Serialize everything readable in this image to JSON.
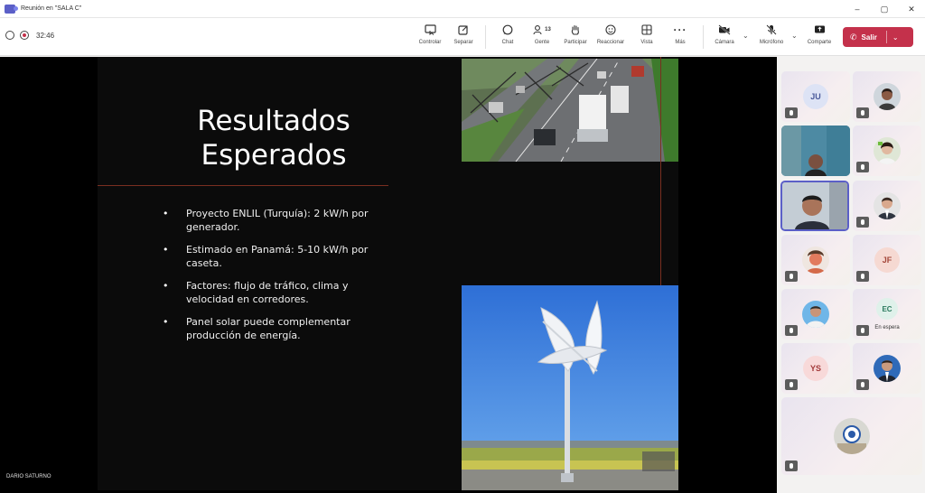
{
  "window": {
    "title": "Reunión en \"SALA C\"",
    "controls": [
      "–",
      "▢",
      "✕"
    ]
  },
  "status": {
    "timer": "32:46"
  },
  "toolbar": {
    "buttons": [
      {
        "label": "Controlar",
        "icon": "screen-control-icon"
      },
      {
        "label": "Separar",
        "icon": "pop-out-icon"
      },
      {
        "label": "Chat",
        "icon": "chat-icon"
      },
      {
        "label": "Gente",
        "icon": "people-icon",
        "count": "13"
      },
      {
        "label": "Participar",
        "icon": "raise-hand-icon"
      },
      {
        "label": "Reaccionar",
        "icon": "emoji-icon"
      },
      {
        "label": "Vista",
        "icon": "grid-view-icon"
      },
      {
        "label": "Más",
        "icon": "more-icon"
      },
      {
        "label": "Cámara",
        "icon": "camera-off-icon"
      },
      {
        "label": "Micrófono",
        "icon": "mic-off-icon"
      },
      {
        "label": "Comparte",
        "icon": "share-icon"
      }
    ],
    "leave_label": "Salir"
  },
  "slide": {
    "title_line1": "Resultados",
    "title_line2": "Esperados",
    "bullets": [
      "Proyecto ENLIL (Turquía): 2 kW/h por generador.",
      "Estimado en Panamá: 5-10 kW/h por caseta.",
      "Factores: flujo de tráfico, clima y velocidad en corredores.",
      "Panel solar puede complementar producción de energía."
    ],
    "presenter": "DARIO SATURNO"
  },
  "gallery": {
    "tiles": [
      {
        "type": "initials",
        "text": "JU",
        "bg": "#dde3f5",
        "fg": "#4a5a9a"
      },
      {
        "type": "photo"
      },
      {
        "type": "video"
      },
      {
        "type": "photo"
      },
      {
        "type": "video-active"
      },
      {
        "type": "photo"
      },
      {
        "type": "photo"
      },
      {
        "type": "initials",
        "text": "JF",
        "bg": "#f6d9d2",
        "fg": "#a4473a"
      },
      {
        "type": "photo"
      },
      {
        "type": "initials",
        "text": "EC",
        "bg": "#dff1ea",
        "fg": "#2b7a5e",
        "note": "En espera"
      },
      {
        "type": "initials",
        "text": "YS",
        "bg": "#f8d9d9",
        "fg": "#a33a3a"
      },
      {
        "type": "photo"
      },
      {
        "type": "photo-wide"
      }
    ]
  },
  "colors": {
    "accent": "#5b5fc7",
    "leave": "#c4314b",
    "slide_rule": "#7a2f20"
  }
}
